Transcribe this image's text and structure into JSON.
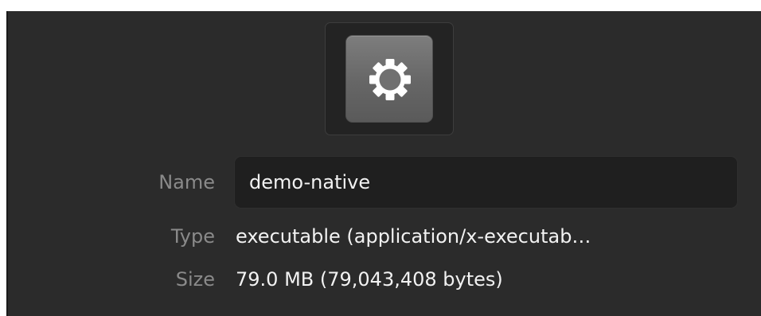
{
  "icon": {
    "name": "gear-icon",
    "bg_color": "#6e6e6e",
    "glyph_color": "#ffffff"
  },
  "properties": {
    "name_label": "Name",
    "name_value": "demo-native",
    "type_label": "Type",
    "type_value": "executable (application/x-executab…",
    "size_label": "Size",
    "size_value": "79.0 MB (79,043,408 bytes)"
  }
}
